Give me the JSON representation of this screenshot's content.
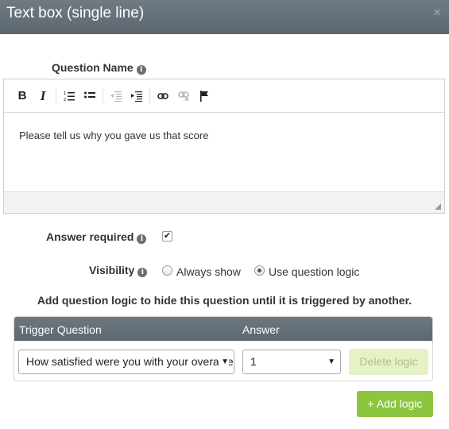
{
  "dialog": {
    "title": "Text box (single line)",
    "close_glyph": "×"
  },
  "question_name": {
    "label": "Question Name",
    "info_icon": "info-circle-icon",
    "text": "Please tell us why you gave us that score"
  },
  "toolbar": {
    "buttons": [
      {
        "name": "bold",
        "glyph": "B"
      },
      {
        "name": "italic",
        "glyph": "I"
      },
      {
        "name": "ordered-list",
        "glyph": "ordered-list-icon"
      },
      {
        "name": "unordered-list",
        "glyph": "unordered-list-icon"
      },
      {
        "name": "outdent",
        "glyph": "outdent-icon"
      },
      {
        "name": "indent",
        "glyph": "indent-icon"
      },
      {
        "name": "link",
        "glyph": "link-icon"
      },
      {
        "name": "unlink",
        "glyph": "unlink-icon"
      },
      {
        "name": "anchor",
        "glyph": "flag-icon"
      }
    ]
  },
  "answer_required": {
    "label": "Answer required",
    "checked": true
  },
  "visibility": {
    "label": "Visibility",
    "options": [
      {
        "label": "Always show",
        "checked": false
      },
      {
        "label": "Use question logic",
        "checked": true
      }
    ]
  },
  "logic": {
    "title": "Add question logic to hide this question until it is triggered by another.",
    "headers": {
      "trigger": "Trigger Question",
      "answer": "Answer"
    },
    "trigger_value": "How satisfied were you with your overall experience?",
    "answer_value": "1",
    "delete_label": "Delete logic",
    "add_label": "+ Add logic"
  },
  "colors": {
    "header_bg": "#5d6770",
    "add_button": "#8cc63f",
    "delete_button_disabled": "#e5f2c6"
  }
}
